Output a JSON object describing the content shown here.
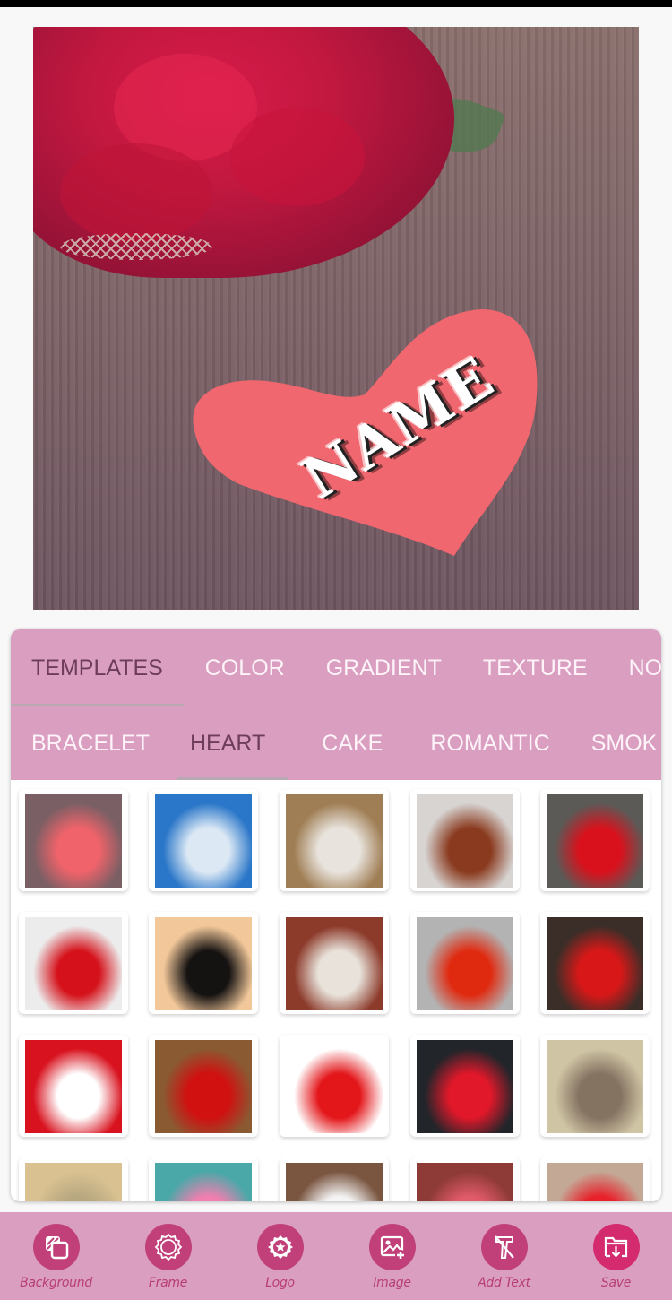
{
  "canvas": {
    "overlay_text": "NAME",
    "background_description": "red rose and crumpled paper heart on wooden table"
  },
  "tabs": {
    "primary": [
      {
        "label": "TEMPLATES",
        "active": true
      },
      {
        "label": "COLOR",
        "active": false
      },
      {
        "label": "GRADIENT",
        "active": false
      },
      {
        "label": "TEXTURE",
        "active": false
      },
      {
        "label": "NO",
        "active": false
      }
    ],
    "secondary": [
      {
        "label": "BRACELET",
        "active": false
      },
      {
        "label": "HEART",
        "active": true
      },
      {
        "label": "CAKE",
        "active": false
      },
      {
        "label": "ROMANTIC",
        "active": false
      },
      {
        "label": "SMOK",
        "active": false
      }
    ]
  },
  "templates": [
    {
      "name": "rose-paper-heart",
      "colors": [
        "#7a5f64",
        "#f0636a"
      ]
    },
    {
      "name": "sparkle-heart-blue",
      "colors": [
        "#2a76c8",
        "#dce9f5"
      ]
    },
    {
      "name": "wooden-heart-frame",
      "colors": [
        "#a07e55",
        "#e8e3dc"
      ]
    },
    {
      "name": "hanging-sign-garden",
      "colors": [
        "#d7d4d2",
        "#8a3a1e"
      ]
    },
    {
      "name": "stitched-red-heart",
      "colors": [
        "#5b5a57",
        "#d9111c"
      ]
    },
    {
      "name": "polygon-red-heart",
      "colors": [
        "#ececec",
        "#d5121b"
      ]
    },
    {
      "name": "hands-heart-sunset",
      "colors": [
        "#f2c89a",
        "#151212"
      ]
    },
    {
      "name": "white-wood-heart",
      "colors": [
        "#8c3a2a",
        "#e8e2da"
      ]
    },
    {
      "name": "glowing-red-heart",
      "colors": [
        "#b3b3b3",
        "#e02a10"
      ]
    },
    {
      "name": "patterned-red-hearts",
      "colors": [
        "#3b2e28",
        "#d81818"
      ]
    },
    {
      "name": "for-you-hearts",
      "colors": [
        "#d8121e",
        "#ffffff"
      ]
    },
    {
      "name": "paper-hearts-bokeh",
      "colors": [
        "#8a5a32",
        "#d11010"
      ]
    },
    {
      "name": "red-balloon-heart",
      "colors": [
        "#ffffff",
        "#e3161a"
      ]
    },
    {
      "name": "painted-heart-asphalt",
      "colors": [
        "#22252a",
        "#e0182a"
      ]
    },
    {
      "name": "leaf-heart",
      "colors": [
        "#cfc4a4",
        "#857362"
      ]
    },
    {
      "name": "gold-paper",
      "colors": [
        "#d9c191",
        "#b8a880"
      ]
    },
    {
      "name": "pink-heart-teal",
      "colors": [
        "#4aa8a8",
        "#f17fb0"
      ]
    },
    {
      "name": "notebook-hearts",
      "colors": [
        "#7a5540",
        "#f4f4f4"
      ]
    },
    {
      "name": "bokeh-hearts",
      "colors": [
        "#8e3a36",
        "#e05a6a"
      ]
    },
    {
      "name": "paper-hearts-beige",
      "colors": [
        "#c4a896",
        "#e8202a"
      ]
    }
  ],
  "toolbar": [
    {
      "label": "Background",
      "icon": "background-layers-icon"
    },
    {
      "label": "Frame",
      "icon": "frame-badge-icon"
    },
    {
      "label": "Logo",
      "icon": "star-badge-icon"
    },
    {
      "label": "Image",
      "icon": "add-image-icon"
    },
    {
      "label": "Add Text",
      "icon": "text-tool-icon"
    },
    {
      "label": "Save",
      "icon": "save-folder-icon"
    }
  ],
  "colors": {
    "tab_bar": "#d99ec0",
    "active_tab_text": "#6e3d5a",
    "inactive_tab_text": "#fdf3f8",
    "tool_circle": "#c2407a",
    "save_circle": "#d42a6e",
    "tool_label": "#b83d76"
  }
}
